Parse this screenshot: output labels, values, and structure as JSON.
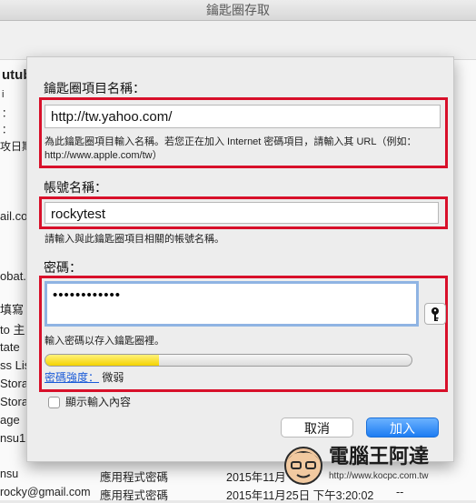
{
  "window": {
    "title": "鑰匙圈存取"
  },
  "background": {
    "header_fragment": "utub",
    "side_colons": [
      "i",
      "：",
      "：",
      "："
    ],
    "date_fragment": "攻日期",
    "left_fragments": [
      "ail.com",
      "obat.co",
      "填寫",
      "to 主",
      "tate",
      "ss Lis",
      "Stora",
      "Stora",
      "age",
      "nsu1",
      "nsu"
    ],
    "rows": [
      {
        "account": "nsu",
        "kind": "應用程式密碼",
        "date": "2015年11月",
        "extra": ""
      },
      {
        "account": "rocky@gmail.com",
        "kind": "應用程式密碼",
        "date": "2015年11月25日 下午3:20:02",
        "extra": "--"
      }
    ]
  },
  "sheet": {
    "item_name_label": "鑰匙圈項目名稱：",
    "item_name_value": "http://tw.yahoo.com/",
    "item_name_hint": "為此鑰匙圈項目輸入名稱。若您正在加入 Internet 密碼項目，請輸入其 URL（例如：http://www.apple.com/tw）",
    "account_label": "帳號名稱：",
    "account_value": "rockytest",
    "account_hint": "請輸入與此鑰匙圈項目相關的帳號名稱。",
    "password_label": "密碼：",
    "password_value": "••••••••••••",
    "password_hint": "輸入密碼以存入鑰匙圈裡。",
    "strength_fraction": 0.31,
    "strength_link": "密碼強度：",
    "strength_value": "微弱",
    "show_password_label": "顯示輸入內容",
    "show_password_checked": false,
    "cancel_label": "取消",
    "add_label": "加入"
  },
  "watermark": {
    "title": "電腦王阿達",
    "url": "http://www.kocpc.com.tw"
  },
  "colors": {
    "highlight": "#d8102a",
    "accent": "#1d7cf2",
    "strength": "#f4d200"
  }
}
